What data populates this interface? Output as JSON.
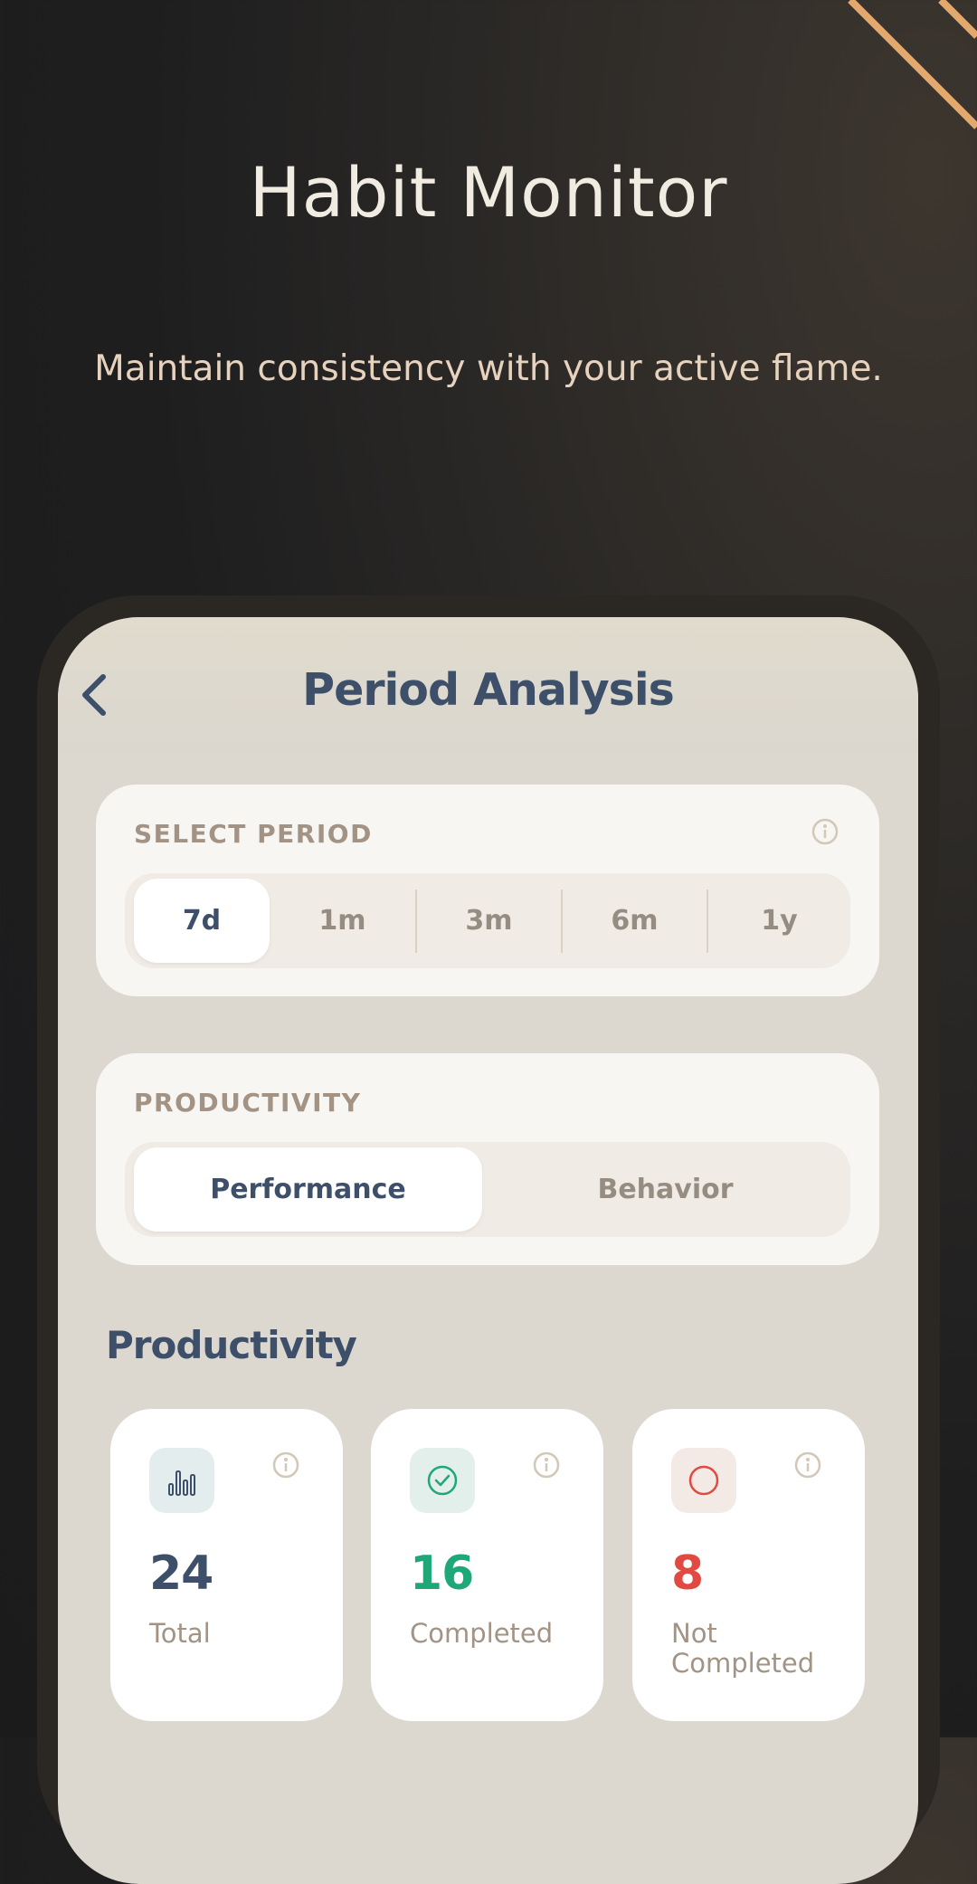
{
  "hero": {
    "title": "Habit Monitor",
    "subtitle": "Maintain consistency with your active flame."
  },
  "app": {
    "title": "Period Analysis"
  },
  "period_card": {
    "label": "SELECT PERIOD",
    "options": [
      "7d",
      "1m",
      "3m",
      "6m",
      "1y"
    ],
    "selected": "7d"
  },
  "productivity_card": {
    "label": "PRODUCTIVITY",
    "options": [
      "Performance",
      "Behavior"
    ],
    "selected": "Performance"
  },
  "section": {
    "title": "Productivity"
  },
  "stats": [
    {
      "value": "24",
      "label": "Total",
      "icon": "bar-chart-icon",
      "color": "#3d4f69"
    },
    {
      "value": "16",
      "label": "Completed",
      "icon": "check-circle-icon",
      "color": "#1fa877"
    },
    {
      "value": "8",
      "label": "Not Completed",
      "icon": "circle-icon",
      "color": "#e04a43"
    }
  ],
  "colors": {
    "accent_line": "#e3a86b",
    "primary_text": "#3d4f69",
    "muted_text": "#a29385"
  }
}
